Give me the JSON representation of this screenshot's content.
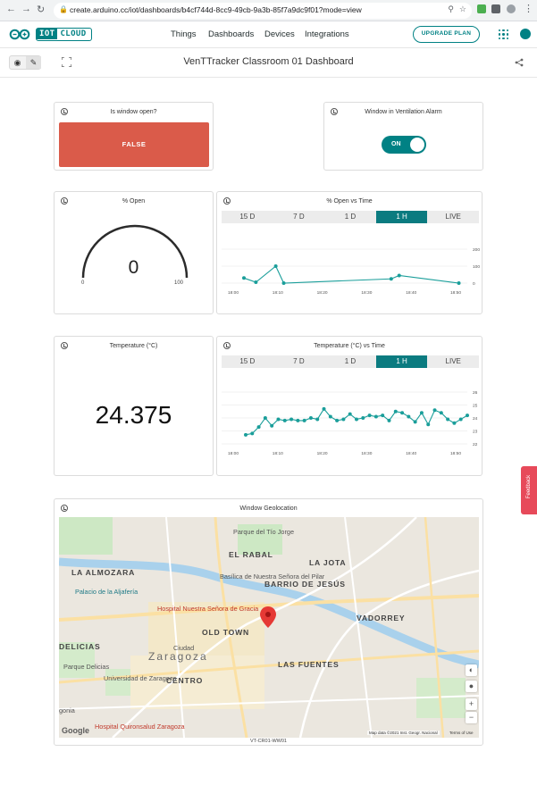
{
  "browser": {
    "url": "create.arduino.cc/iot/dashboards/b4cf744d-8cc9-49cb-9a3b-85f7a9dc9f01?mode=view"
  },
  "header": {
    "logo_text_highlight": "IOT",
    "logo_text": "CLOUD",
    "nav": [
      "Things",
      "Dashboards",
      "Devices",
      "Integrations"
    ],
    "upgrade_label": "UPGRADE PLAN"
  },
  "toolbar": {
    "title": "VenTTracker Classroom 01 Dashboard"
  },
  "widgets": {
    "window_open": {
      "title": "Is window open?",
      "value": "FALSE"
    },
    "alarm": {
      "title": "Window in Ventilation Alarm",
      "state": "ON"
    },
    "gauge": {
      "title": "% Open",
      "value": "0",
      "min": "0",
      "max": "100"
    },
    "open_chart": {
      "title": "% Open vs Time",
      "tabs": [
        "15 D",
        "7 D",
        "1 D",
        "1 H",
        "LIVE"
      ],
      "active_tab": "1 H"
    },
    "temperature": {
      "title": "Temperature (°C)",
      "value": "24.375"
    },
    "temp_chart": {
      "title": "Temperature (°C) vs Time",
      "tabs": [
        "15 D",
        "7 D",
        "1 D",
        "1 H",
        "LIVE"
      ],
      "active_tab": "1 H"
    },
    "map": {
      "title": "Window Geolocation",
      "caption": "VT-CR01-WW01",
      "google": "Google",
      "attribution": "Map data ©2021 Inst. Geogr. Nacional",
      "terms": "Terms of Use",
      "zoom_in": "+",
      "zoom_out": "−",
      "labels": {
        "la_almozara": "LA ALMOZARA",
        "palacio": "Palacio de la Aljafería",
        "hospital_nuestra": "Hospital Nuestra Señora de Gracia",
        "old_town": "OLD TOWN",
        "zaragoza": "Zaragoza",
        "delicias": "DELICIAS",
        "centro": "CENTRO",
        "las_fuentes": "LAS FUENTES",
        "el_rabal": "EL RABAL",
        "la_jota": "LA JOTA",
        "barrio_jesus": "BARRIO DE JESÚS",
        "vadorrey": "VADORREY",
        "parque_tio_jorge": "Parque del Tío Jorge",
        "basilica": "Basílica de Nuestra Señora del Pilar",
        "universidad": "Universidad de Zaragoza",
        "parque_delicias": "Parque Delicias",
        "hospital_quiron": "Hospital Quironsalud Zaragoza",
        "ciudad": "Ciudad",
        "gota": "gonia"
      }
    }
  },
  "chart_data": [
    {
      "type": "line",
      "title": "% Open vs Time",
      "x": [
        "18:00",
        "18:03",
        "18:08",
        "18:10",
        "18:37",
        "18:39",
        "18:54"
      ],
      "x_ticks": [
        "18:00",
        "18:10",
        "18:20",
        "18:30",
        "18:40",
        "18:50"
      ],
      "y_ticks": [
        "200",
        "100",
        "0"
      ],
      "values": [
        30,
        5,
        100,
        0,
        25,
        45,
        0
      ],
      "ylim": [
        0,
        200
      ],
      "color": "#1a9e9a"
    },
    {
      "type": "line",
      "title": "Temperature (°C) vs Time",
      "x_ticks": [
        "18:00",
        "18:10",
        "18:20",
        "18:30",
        "18:40",
        "18:50"
      ],
      "y_ticks": [
        "26",
        "25",
        "24",
        "23",
        "22"
      ],
      "values": [
        22.7,
        22.8,
        23.3,
        24.0,
        23.4,
        23.9,
        23.8,
        23.9,
        23.8,
        23.8,
        24.0,
        23.9,
        24.7,
        24.1,
        23.8,
        23.9,
        24.3,
        23.9,
        24.0,
        24.2,
        24.1,
        24.2,
        23.8,
        24.5,
        24.4,
        24.1,
        23.7,
        24.4,
        23.5,
        24.6,
        24.4,
        23.9,
        23.6,
        23.9,
        24.2
      ],
      "ylim": [
        22,
        26
      ],
      "color": "#1a9e9a"
    }
  ],
  "colors": {
    "brand": "#008184",
    "alarm_red": "#da5b4a",
    "series": "#1a9e9a",
    "feedback": "#e74a5a"
  },
  "feedback": {
    "label": "Feedback"
  }
}
